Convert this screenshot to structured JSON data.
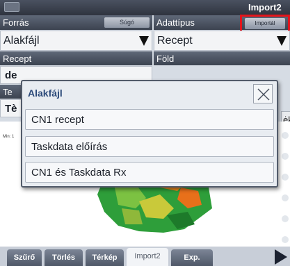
{
  "titlebar": {
    "title": "Import2"
  },
  "header": {
    "source_label": "Forrás",
    "help_label": "Súgó",
    "datatype_label": "Adattípus",
    "import_label": "Importál"
  },
  "fields": {
    "source_value": "Alakfájl",
    "datatype_value": "Recept"
  },
  "row2": {
    "recipe_label": "Recept",
    "field_label": "Föld",
    "recipe_value": "de"
  },
  "row3": {
    "label": "Te",
    "value": "Tè",
    "side_button": "ėk"
  },
  "map": {
    "min_label": "Min: 1"
  },
  "modal": {
    "title": "Alakfájl",
    "options": [
      "CN1 recept",
      "Taskdata előírás",
      "CN1 és Taskdata Rx"
    ]
  },
  "tabs": [
    "Szűrő",
    "Törlés",
    "Térkép",
    "Import2",
    "Exp."
  ],
  "colors": {
    "highlight": "#e3141b",
    "accent": "#2c4a7a"
  }
}
